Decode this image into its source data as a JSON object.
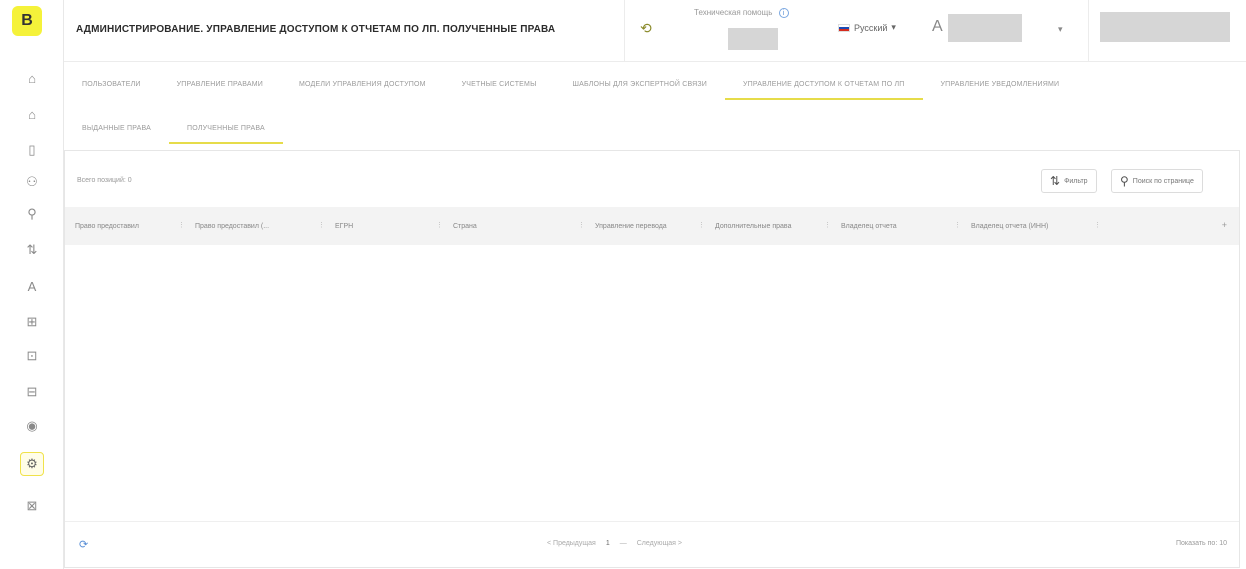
{
  "app": {
    "logo_letter": "B"
  },
  "header": {
    "title": "АДМИНИСТРИРОВАНИЕ. УПРАВЛЕНИЕ ДОСТУПОМ К ОТЧЕТАМ ПО ЛП. ПОЛУЧЕННЫЕ ПРАВА",
    "tech_support": "Техническая помощь",
    "info_icon": "i",
    "bell_icon": "⟲",
    "language": "Русский",
    "language_chevron": "▾",
    "user_icon": "A",
    "user_chevron": "▾"
  },
  "sidebar": {
    "items": [
      {
        "icon": "⌂",
        "name": "home-icon"
      },
      {
        "icon": "⌂",
        "name": "building-icon"
      },
      {
        "icon": "▯",
        "name": "document-icon"
      },
      {
        "icon": "⚇",
        "name": "people-icon"
      },
      {
        "icon": "⚲",
        "name": "search-icon"
      },
      {
        "icon": "⇅",
        "name": "transfer-icon"
      },
      {
        "icon": "A",
        "name": "user-icon"
      },
      {
        "icon": "⊞",
        "name": "grid-icon"
      },
      {
        "icon": "⊡",
        "name": "table-icon"
      },
      {
        "icon": "⊟",
        "name": "list-icon"
      },
      {
        "icon": "◉",
        "name": "globe-icon"
      },
      {
        "icon": "⚙",
        "name": "settings-icon"
      },
      {
        "icon": "⊠",
        "name": "exit-icon"
      }
    ]
  },
  "tabs_main": [
    {
      "label": "Пользователи"
    },
    {
      "label": "Управление правами"
    },
    {
      "label": "Модели управления доступом"
    },
    {
      "label": "Учетные системы"
    },
    {
      "label": "Шаблоны для экспертной связи"
    },
    {
      "label": "Управление доступом к отчетам по ЛП"
    },
    {
      "label": "Управление уведомлениями"
    }
  ],
  "tabs_sub": [
    {
      "label": "Выданные права"
    },
    {
      "label": "Полученные права"
    }
  ],
  "table": {
    "total": "Всего позиций: 0",
    "filters_label": "Фильтр",
    "filters_icon": "⇅",
    "search_label": "Поиск по странице",
    "search_icon": "⚲",
    "columns": [
      "Право предоставил",
      "Право предоставил (...",
      "ЕГРН",
      "Страна",
      "Управление перевода",
      "Дополнительные права",
      "Владелец отчета",
      "Владелец отчета (ИНН)"
    ],
    "add_column_icon": "+",
    "column_sep": "⋮"
  },
  "footer": {
    "refresh_icon": "⟳",
    "prev": "< Предыдущая",
    "page": "1",
    "sep": "—",
    "next": "Следующая >",
    "show": "Показать по: 10"
  }
}
